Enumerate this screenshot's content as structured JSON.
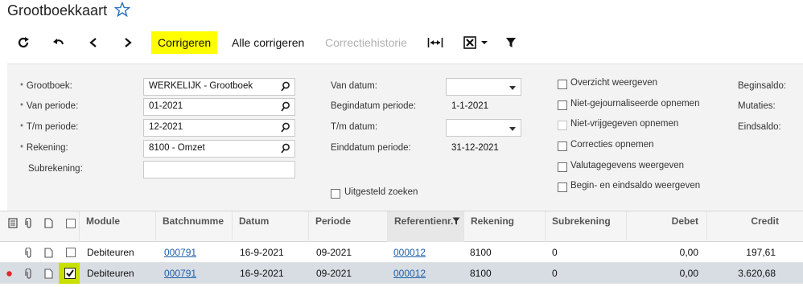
{
  "title": "Grootboekkaart",
  "toolbar": {
    "correct_label": "Corrigeren",
    "correct_all_label": "Alle corrigeren",
    "history_label": "Correctiehistorie"
  },
  "filters": {
    "grootboek": {
      "label": "Grootboek:",
      "value": "WERKELIJK - Grootboek"
    },
    "van_periode": {
      "label": "Van periode:",
      "value": "01-2021"
    },
    "tm_periode": {
      "label": "T/m periode:",
      "value": "12-2021"
    },
    "rekening": {
      "label": "Rekening:",
      "value": "8100 - Omzet"
    },
    "subrekening": {
      "label": "Subrekening:",
      "value": ""
    },
    "van_datum": {
      "label": "Van datum:",
      "value": ""
    },
    "begindatum_periode": {
      "label": "Begindatum periode:",
      "value": "1-1-2021"
    },
    "tm_datum": {
      "label": "T/m datum:",
      "value": ""
    },
    "einddatum_periode": {
      "label": "Einddatum periode:",
      "value": "31-12-2021"
    },
    "uitgesteld_zoeken": "Uitgesteld zoeken",
    "options": [
      "Overzicht weergeven",
      "Niet-gejournaliseerde opnemen",
      "Niet-vrijgegeven opnemen",
      "Correcties opnemen",
      "Valutagegevens weergeven",
      "Begin- en eindsaldo weergeven"
    ],
    "beginsaldo": "Beginsaldo:",
    "mutaties": "Mutaties:",
    "eindsaldo": "Eindsaldo:"
  },
  "grid": {
    "columns": {
      "module": "Module",
      "batch": "Batchnumme",
      "datum": "Datum",
      "periode": "Periode",
      "ref": "Referentienr.",
      "rekening": "Rekening",
      "subrekening": "Subrekening",
      "debet": "Debet",
      "credit": "Credit"
    },
    "rows": [
      {
        "module": "Debiteuren",
        "batch": "000791",
        "datum": "16-9-2021",
        "periode": "09-2021",
        "ref": "000012",
        "rekening": "8100",
        "subrekening": "0",
        "debet": "0,00",
        "credit": "197,61",
        "checked": false
      },
      {
        "module": "Debiteuren",
        "batch": "000791",
        "datum": "16-9-2021",
        "periode": "09-2021",
        "ref": "000012",
        "rekening": "8100",
        "subrekening": "0",
        "debet": "0,00",
        "credit": "3.620,68",
        "checked": true
      }
    ]
  },
  "colors": {
    "highlight": "#ffff00",
    "link": "#1f5fa8",
    "selected_row": "#d8dde3",
    "row_marker": "#e0262b"
  }
}
